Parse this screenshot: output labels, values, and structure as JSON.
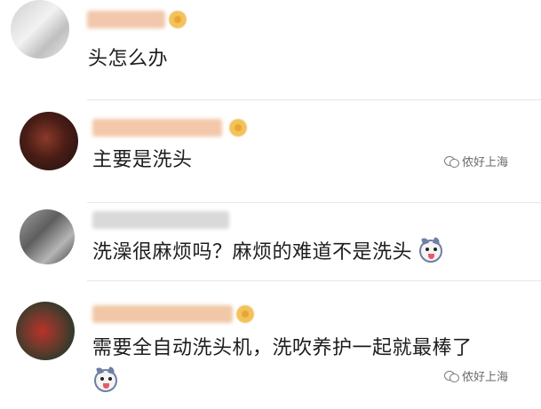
{
  "comments": [
    {
      "text": "头怎么办",
      "emoji": false
    },
    {
      "text": "主要是洗头",
      "emoji": false
    },
    {
      "text": "洗澡很麻烦吗？麻烦的难道不是洗头",
      "emoji": true
    },
    {
      "text": "需要全自动洗头机，洗吹养护一起就最棒了",
      "emoji": true
    }
  ],
  "watermark": {
    "label": "侬好上海"
  },
  "colors": {
    "text": "#1d1d1d",
    "divider": "#e6e6e6",
    "badge": "#f3c25b",
    "name_blur": "#f3c9a8"
  },
  "icons": {
    "badge": "verified-badge-icon",
    "emoji": "husky-emoji-icon",
    "watermark": "wechat-icon"
  }
}
